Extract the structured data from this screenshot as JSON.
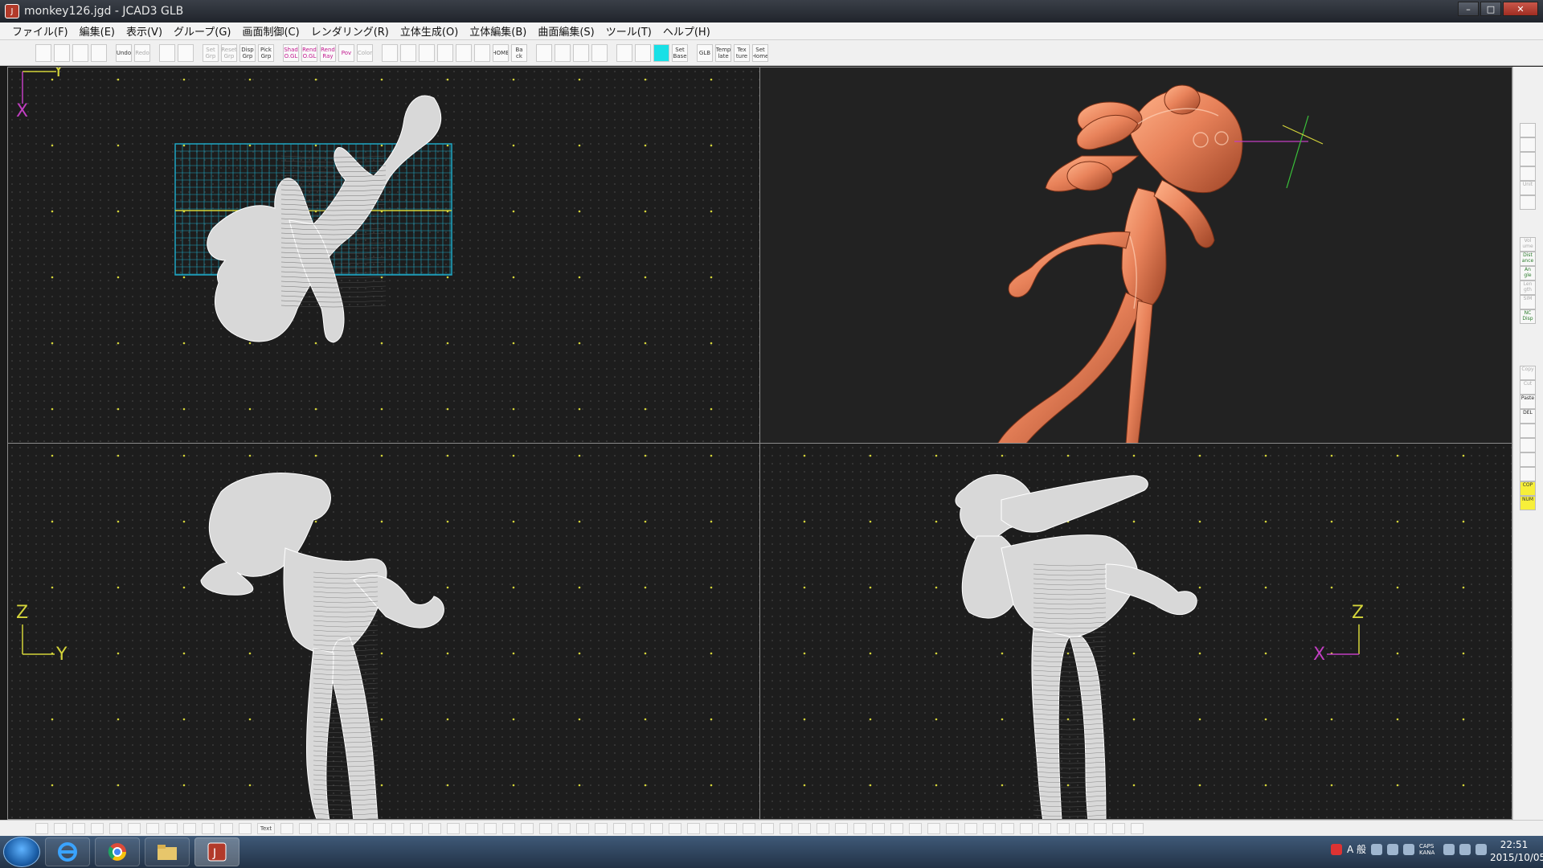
{
  "window": {
    "title": "monkey126.jgd - JCAD3 GLB"
  },
  "menu": [
    "ファイル(F)",
    "編集(E)",
    "表示(V)",
    "グループ(G)",
    "画面制御(C)",
    "レンダリング(R)",
    "立体生成(O)",
    "立体編集(B)",
    "曲面編集(S)",
    "ツール(T)",
    "ヘルプ(H)"
  ],
  "toolbar": {
    "groups": [
      [
        {
          "name": "new",
          "label": ""
        },
        {
          "name": "open",
          "label": ""
        },
        {
          "name": "save",
          "label": ""
        },
        {
          "name": "print",
          "label": ""
        }
      ],
      [
        {
          "name": "undo",
          "label": "Undo"
        },
        {
          "name": "redo",
          "label": "Redo"
        }
      ],
      [
        {
          "name": "copy-view",
          "label": ""
        },
        {
          "name": "grid-view",
          "label": ""
        }
      ],
      [
        {
          "name": "set-grp",
          "label": "Set Grp"
        },
        {
          "name": "reset-grp",
          "label": "Reset Grp"
        },
        {
          "name": "disp-grp",
          "label": "Disp Grp"
        },
        {
          "name": "pick-grp",
          "label": "Pick Grp"
        }
      ],
      [
        {
          "name": "shad-ogl",
          "label": "Shad O.GL"
        },
        {
          "name": "rend-ogl",
          "label": "Rend O.GL"
        },
        {
          "name": "rend-ray",
          "label": "Rend Ray"
        },
        {
          "name": "pov",
          "label": "Pov"
        },
        {
          "name": "color",
          "label": "Color"
        }
      ],
      [
        {
          "name": "zoom-in",
          "label": ""
        },
        {
          "name": "zoom-out",
          "label": ""
        },
        {
          "name": "zoom-window",
          "label": ""
        },
        {
          "name": "zoom-all",
          "label": ""
        },
        {
          "name": "zoom-fit",
          "label": ""
        },
        {
          "name": "pan",
          "label": ""
        },
        {
          "name": "home",
          "label": "HOME"
        },
        {
          "name": "back",
          "label": "Ba ck"
        }
      ],
      [
        {
          "name": "rot-a",
          "label": ""
        },
        {
          "name": "rot-b",
          "label": ""
        },
        {
          "name": "rot-c",
          "label": ""
        },
        {
          "name": "rot-d",
          "label": ""
        }
      ],
      [
        {
          "name": "grid-a",
          "label": ""
        },
        {
          "name": "grid-b",
          "label": ""
        },
        {
          "name": "grid-c",
          "label": ""
        },
        {
          "name": "set-base",
          "label": "Set Base"
        }
      ],
      [
        {
          "name": "glb",
          "label": "GLB"
        },
        {
          "name": "template",
          "label": "Temp late"
        },
        {
          "name": "texture",
          "label": "Tex ture"
        },
        {
          "name": "set-home",
          "label": "Set Home"
        }
      ]
    ]
  },
  "viewports": {
    "top_left": {
      "axis_v": "Y",
      "axis_h": "X"
    },
    "bottom_left": {
      "axis_v": "Z",
      "axis_h": "Y"
    },
    "bottom_right": {
      "axis_v": "Z",
      "axis_h": "X"
    }
  },
  "right_sidebar": [
    {
      "name": "tool-1",
      "label": "",
      "style": "gray"
    },
    {
      "name": "tool-2",
      "label": "",
      "style": "gray"
    },
    {
      "name": "tool-3",
      "label": "",
      "style": "gray"
    },
    {
      "name": "tool-4",
      "label": "",
      "style": "dark"
    },
    {
      "name": "unit",
      "label": "Unit",
      "style": "gray"
    },
    {
      "name": "tool-6",
      "label": "",
      "style": "gray"
    },
    {
      "name": "volume",
      "label": "Vol ume",
      "style": "gray"
    },
    {
      "name": "distance",
      "label": "Dist ance",
      "style": ""
    },
    {
      "name": "angle",
      "label": "An gle",
      "style": ""
    },
    {
      "name": "length",
      "label": "Len gth",
      "style": "gray"
    },
    {
      "name": "sim",
      "label": "SIM",
      "style": "gray"
    },
    {
      "name": "nc-disp",
      "label": "NC Disp",
      "style": ""
    },
    {
      "name": "copy",
      "label": "Copy",
      "style": "gray"
    },
    {
      "name": "cut",
      "label": "Cut",
      "style": "gray"
    },
    {
      "name": "paste",
      "label": "Paste",
      "style": "dark"
    },
    {
      "name": "del",
      "label": "DEL",
      "style": "dark"
    },
    {
      "name": "tool-17",
      "label": "",
      "style": "dark"
    },
    {
      "name": "tool-18",
      "label": "",
      "style": "gray"
    },
    {
      "name": "tool-19",
      "label": "",
      "style": "dark"
    },
    {
      "name": "tool-20",
      "label": "",
      "style": "dark"
    },
    {
      "name": "cop",
      "label": "COP",
      "style": "yellow"
    },
    {
      "name": "num",
      "label": "NUM",
      "style": "yellow"
    }
  ],
  "bottom_toolbar_text": "Text",
  "taskbar": {
    "apps": [
      "windows-explorer",
      "internet-explorer",
      "chrome",
      "folder",
      "jcad3"
    ],
    "tray_text": "A 般",
    "caps": "CAPS KANA",
    "time": "22:51",
    "date": "2015/10/05"
  },
  "colors": {
    "model_render": "#e8825a",
    "wire": "#d8d8d8",
    "grid_plane": "#1fa6c4",
    "axis_y": "#d4d43a",
    "axis_x": "#c23ec2"
  }
}
